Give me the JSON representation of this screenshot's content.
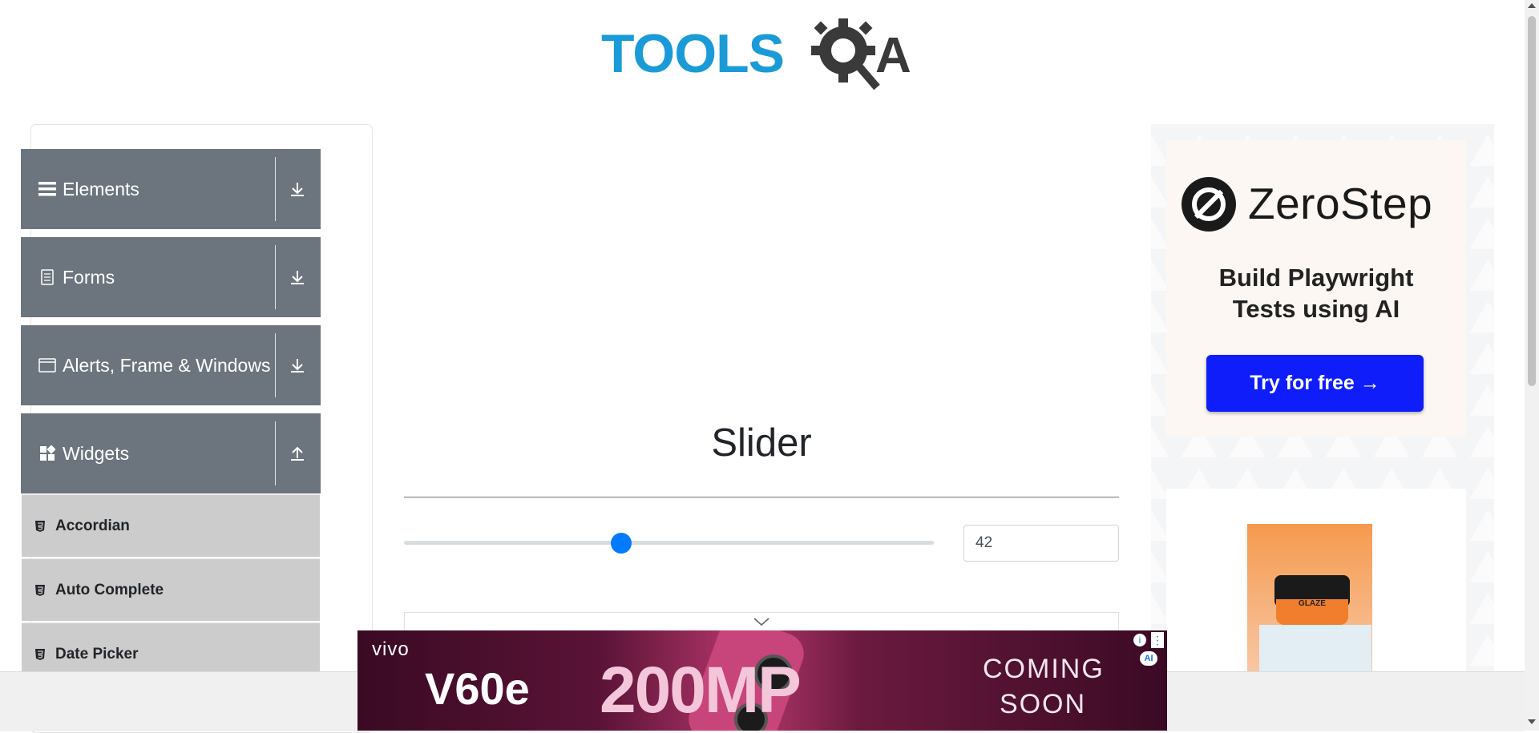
{
  "header": {
    "logo_text_primary": "TOOLS",
    "logo_text_secondary": "QA",
    "logo_colors": {
      "primary": "#1a9bd7",
      "secondary": "#3a3a3a"
    }
  },
  "sidebar": {
    "groups": [
      {
        "label": "Elements",
        "icon": "list-icon",
        "expanded": false,
        "arrow": "download-icon"
      },
      {
        "label": "Forms",
        "icon": "document-icon",
        "expanded": false,
        "arrow": "download-icon"
      },
      {
        "label": "Alerts, Frame & Windows",
        "icon": "window-icon",
        "expanded": false,
        "arrow": "download-icon"
      },
      {
        "label": "Widgets",
        "icon": "widgets-icon",
        "expanded": true,
        "arrow": "upload-icon"
      }
    ],
    "widget_items": [
      {
        "label": "Accordian",
        "icon": "html5-icon"
      },
      {
        "label": "Auto Complete",
        "icon": "html5-icon"
      },
      {
        "label": "Date Picker",
        "icon": "html5-icon"
      }
    ],
    "colors": {
      "header_bg": "#6c757d",
      "item_bg": "#cccccc"
    }
  },
  "main": {
    "title": "Slider",
    "slider": {
      "value": 42,
      "min": 0,
      "max": 100,
      "accent": "#007bff"
    },
    "slider_value_text": "42"
  },
  "right_ad": {
    "brand": "ZeroStep",
    "tagline_line1": "Build Playwright",
    "tagline_line2": "Tests using AI",
    "cta": "Try for free →",
    "cta_color": "#0f1dfb",
    "product_label": "GLAZE"
  },
  "banner_ad": {
    "brand": "vivo",
    "model": "V60e",
    "megapixels": "200MP",
    "coming_line1": "COMING",
    "coming_line2": "SOON",
    "info_glyph": "i",
    "ai_badge": "AI"
  }
}
